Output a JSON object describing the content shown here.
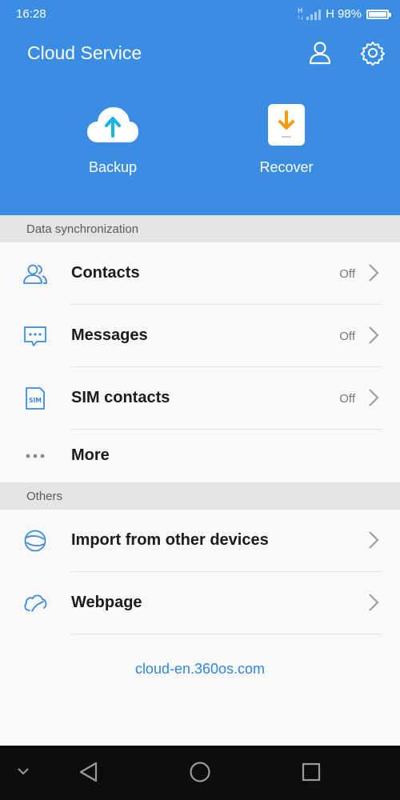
{
  "status_bar": {
    "time": "16:28",
    "signal_top": "H",
    "signal_bottom": "↑↓",
    "network": "H",
    "battery": "98%"
  },
  "header": {
    "title": "Cloud Service",
    "user_icon": "user-icon",
    "settings_icon": "gear-icon",
    "backup_label": "Backup",
    "recover_label": "Recover"
  },
  "sections": {
    "sync_title": "Data synchronization",
    "others_title": "Others"
  },
  "sync_items": [
    {
      "label": "Contacts",
      "status": "Off",
      "icon": "contacts-icon"
    },
    {
      "label": "Messages",
      "status": "Off",
      "icon": "message-icon"
    },
    {
      "label": "SIM contacts",
      "status": "Off",
      "icon": "sim-icon"
    },
    {
      "label": "More",
      "icon": "more-dots-icon"
    }
  ],
  "other_items": [
    {
      "label": "Import from other devices",
      "icon": "import-icon"
    },
    {
      "label": "Webpage",
      "icon": "webpage-icon"
    }
  ],
  "footer_link": "cloud-en.360os.com",
  "colors": {
    "header_bg": "#3b8de3",
    "accent": "#2f86dd",
    "recover_orange": "#f39c12",
    "section_bg": "#e4e4e4"
  }
}
